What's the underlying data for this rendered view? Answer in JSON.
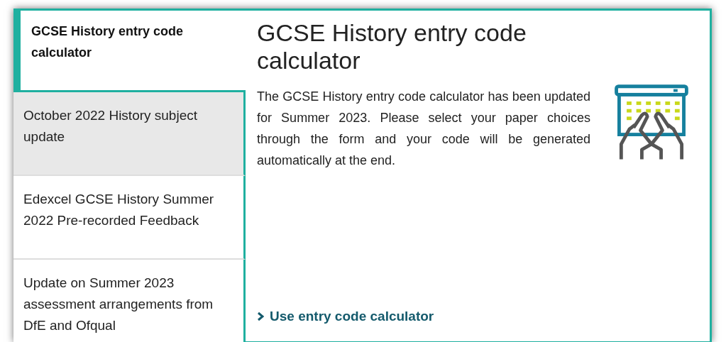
{
  "tabs": [
    {
      "label": "GCSE History entry code calculator",
      "selected": true,
      "highlighted": false
    },
    {
      "label": "October 2022 History subject update",
      "selected": false,
      "highlighted": true
    },
    {
      "label": "Edexcel GCSE History Summer 2022 Pre-recorded Feedback",
      "selected": false,
      "highlighted": false
    },
    {
      "label": "Update on Summer 2023 assessment arrangements from DfE and Ofqual",
      "selected": false,
      "highlighted": false
    }
  ],
  "panel": {
    "title": "GCSE History entry code calculator",
    "body": "The GCSE History entry code calculator has been updated for Summer 2023. Please select your paper choices through the form and your code will be generated automatically at the end.",
    "link": "Use entry code calculator"
  }
}
